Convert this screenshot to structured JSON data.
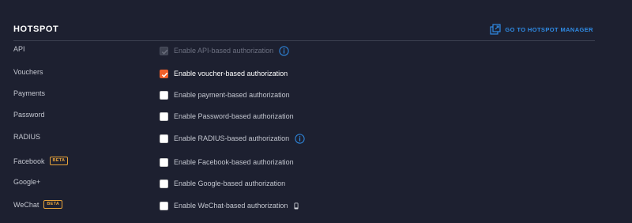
{
  "section": {
    "title": "HOTSPOT",
    "manager_link": "GO TO HOTSPOT MANAGER"
  },
  "colors": {
    "background": "#1d2030",
    "accent": "#2f8ce6",
    "checked": "#f0602a",
    "beta": "#e8a33a"
  },
  "rows": [
    {
      "label": "API",
      "option": "Enable API-based authorization",
      "state": "disabled-checked",
      "icon": "info-icon"
    },
    {
      "label": "Vouchers",
      "option": "Enable voucher-based authorization",
      "state": "checked"
    },
    {
      "label": "Payments",
      "option": "Enable payment-based authorization",
      "state": "unchecked"
    },
    {
      "label": "Password",
      "option": "Enable Password-based authorization",
      "state": "unchecked"
    },
    {
      "label": "RADIUS",
      "option": "Enable RADIUS-based authorization",
      "state": "unchecked",
      "icon": "info-icon"
    },
    {
      "label": "Facebook",
      "badge": "BETA",
      "option": "Enable Facebook-based authorization",
      "state": "unchecked"
    },
    {
      "label": "Google+",
      "option": "Enable Google-based authorization",
      "state": "unchecked"
    },
    {
      "label": "WeChat",
      "badge": "BETA",
      "option": "Enable WeChat-based authorization",
      "state": "unchecked",
      "icon": "phone-icon"
    }
  ]
}
